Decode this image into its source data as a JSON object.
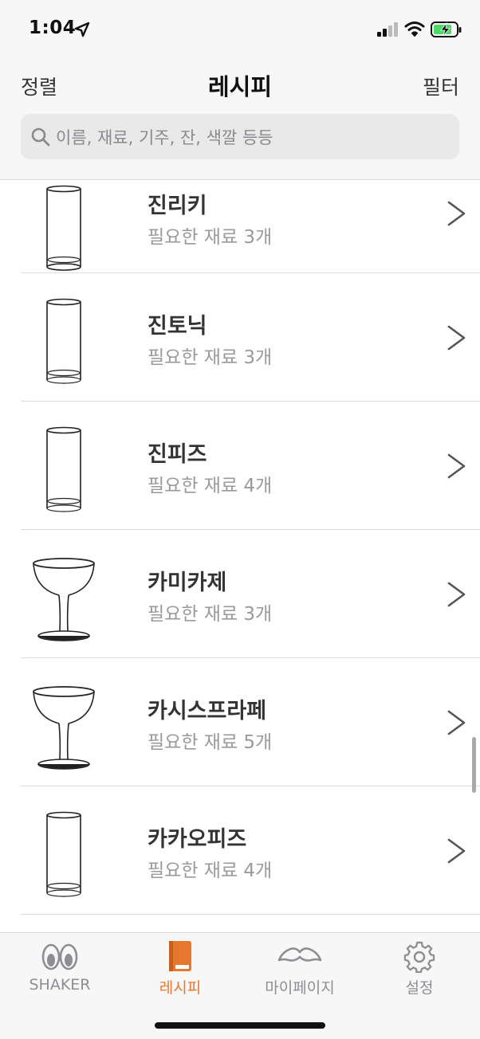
{
  "status_bar": {
    "time": "1:04"
  },
  "nav": {
    "sort_label": "정렬",
    "title": "레시피",
    "filter_label": "필터"
  },
  "search": {
    "placeholder": "이름, 재료, 기주, 잔, 색깔 등등"
  },
  "recipes": [
    {
      "name": "진리키",
      "ingredients": "필요한 재료 3개",
      "glass": "highball-glass-icon"
    },
    {
      "name": "진토닉",
      "ingredients": "필요한 재료 3개",
      "glass": "highball-glass-icon"
    },
    {
      "name": "진피즈",
      "ingredients": "필요한 재료 4개",
      "glass": "highball-glass-icon"
    },
    {
      "name": "카미카제",
      "ingredients": "필요한 재료 3개",
      "glass": "coupe-glass-icon"
    },
    {
      "name": "카시스프라페",
      "ingredients": "필요한 재료 5개",
      "glass": "coupe-glass-icon"
    },
    {
      "name": "카카오피즈",
      "ingredients": "필요한 재료 4개",
      "glass": "highball-glass-icon"
    }
  ],
  "tabs": [
    {
      "label": "SHAKER",
      "icon": "eyes-icon",
      "active": false
    },
    {
      "label": "레시피",
      "icon": "book-icon",
      "active": true
    },
    {
      "label": "마이페이지",
      "icon": "mustache-icon",
      "active": false
    },
    {
      "label": "설정",
      "icon": "gear-icon",
      "active": false
    }
  ],
  "colors": {
    "accent": "#e8772e",
    "inactive": "#8e8e93",
    "bar_bg": "#f7f7f7",
    "battery_green": "#4cd964"
  }
}
